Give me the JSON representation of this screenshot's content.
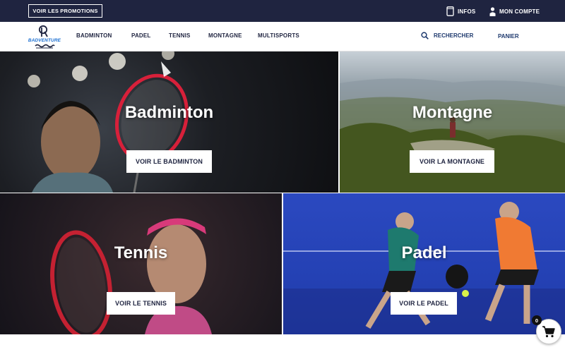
{
  "topbar": {
    "promo_label": "VOIR LES PROMOTIONS",
    "infos_label": "INFOS",
    "account_label": "MON COMPTE"
  },
  "header": {
    "logo_text": "BADVENTURE",
    "nav": [
      {
        "label": "BADMINTON"
      },
      {
        "label": "PADEL"
      },
      {
        "label": "TENNIS"
      },
      {
        "label": "MONTAGNE"
      },
      {
        "label": "MULTISPORTS"
      }
    ],
    "search_label": "RECHERCHER",
    "cart_label": "PANIER"
  },
  "tiles": [
    {
      "title": "Badminton",
      "button": "VOIR LE BADMINTON"
    },
    {
      "title": "Montagne",
      "button": "VOIR LA MONTAGNE"
    },
    {
      "title": "Tennis",
      "button": "VOIR LE TENNIS"
    },
    {
      "title": "Padel",
      "button": "VOIR LE PADEL"
    }
  ],
  "cart": {
    "count": "0"
  },
  "colors": {
    "topbar": "#1f2440",
    "brand_blue": "#1b6fd1",
    "text_dark": "#1f2440"
  },
  "icons": [
    "tablet-icon",
    "user-icon",
    "search-icon",
    "cart-icon",
    "logo-icon"
  ]
}
